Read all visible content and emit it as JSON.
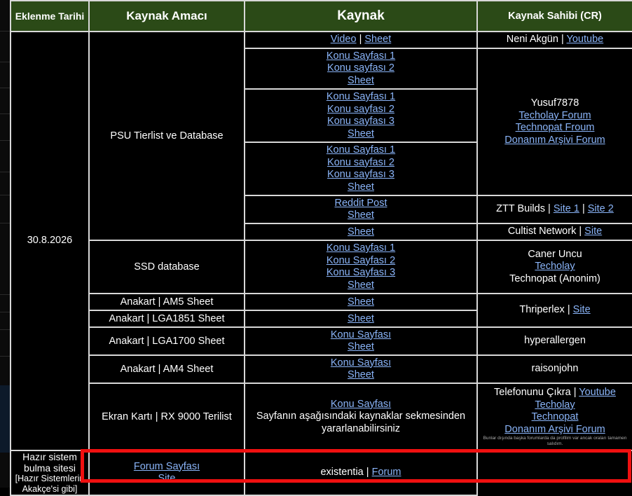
{
  "headers": {
    "date": "Eklenme Tarihi",
    "purpose": "Kaynak Amacı",
    "source": "Kaynak",
    "owner": "Kaynak Sahibi (CR)"
  },
  "date": "30.8.2026",
  "psu": {
    "purpose": "PSU Tierlist ve Database",
    "r1": {
      "video": "Video",
      "sep": "|",
      "sheet": "Sheet",
      "owner_name": "Neni Akgün",
      "owner_sep": "|",
      "owner_link": "Youtube"
    },
    "r2": {
      "l1": "Konu Sayfası 1",
      "l2": "Konu sayfası 2",
      "l3": "Sheet"
    },
    "r3": {
      "l1": "Konu Sayfası 1",
      "l2": "Konu sayfası 2",
      "l3": "Konu sayfası 3",
      "l4": "Sheet"
    },
    "r4": {
      "l1": "Konu Sayfası 1",
      "l2": "Konu sayfası 2",
      "l3": "Konu sayfası 3",
      "l4": "Sheet"
    },
    "yusuf": {
      "name": "Yusuf7878",
      "l1": "Techolay Forum",
      "l2": "Technopat Froum",
      "l3": "Donanım Arşivi Forum"
    },
    "r5": {
      "l1": "Reddit Post",
      "l2": "Sheet",
      "owner_name": "ZTT Builds",
      "sep": "|",
      "owner_l1": "Site 1",
      "owner_l2": "Site 2"
    },
    "r6": {
      "l1": "Sheet",
      "owner_name": "Cultist Network",
      "sep": "|",
      "owner_link": "Site"
    }
  },
  "ssd": {
    "purpose": "SSD database",
    "l1": "Konu Sayfası 1",
    "l2": "Konu Sayfası 2",
    "l3": "Konu Sayfası 3",
    "l4": "Sheet",
    "owner1": "Caner Uncu",
    "owner_link": "Techolay",
    "owner2": "Technopat (Anonim)"
  },
  "mb": {
    "am5": {
      "purpose": "Anakart | AM5 Sheet",
      "link": "Sheet"
    },
    "lga1851": {
      "purpose": "Anakart | LGA1851 Sheet",
      "link": "Sheet"
    },
    "thrip": {
      "name": "Thriperlex",
      "sep": "|",
      "link": "Site"
    },
    "lga1700": {
      "purpose": "Anakart | LGA1700 Sheet",
      "l1": "Konu Sayfası",
      "l2": "Sheet",
      "owner": "hyperallergen"
    },
    "am4": {
      "purpose": "Anakart | AM4 Sheet",
      "l1": "Konu Sayfası",
      "l2": "Sheet",
      "owner": "raisonjohn"
    }
  },
  "gpu": {
    "purpose": "Ekran Kartı | RX 9000 Terilist",
    "link": "Konu Sayfası",
    "desc": "Sayfanın aşağısındaki kaynaklar sekmesinden yararlanabilirsiniz",
    "owner_name": "Telefonunu Çıkra",
    "sep": "|",
    "owner_l1": "Youtube",
    "owner_l2": "Techolay",
    "owner_l3": "Technopat",
    "owner_l4": "Donanım Arşivi Forum",
    "note": "Bunlar dışında başka forumlarda da profilim var ancak oraları tamamen salıdım."
  },
  "prebuilt": {
    "purpose1": "Hazır sistem bulma sitesi",
    "purpose2": "[Hazır Sistemlerin Akakçe'si gibi]",
    "l1": "Forum Sayfası",
    "l2": "Site",
    "owner_name": "existentia",
    "sep": "|",
    "owner_link": "Forum"
  },
  "colors": {
    "header_bg": "#2b4a17",
    "link": "#8ab4f8",
    "highlight": "#f01010"
  }
}
